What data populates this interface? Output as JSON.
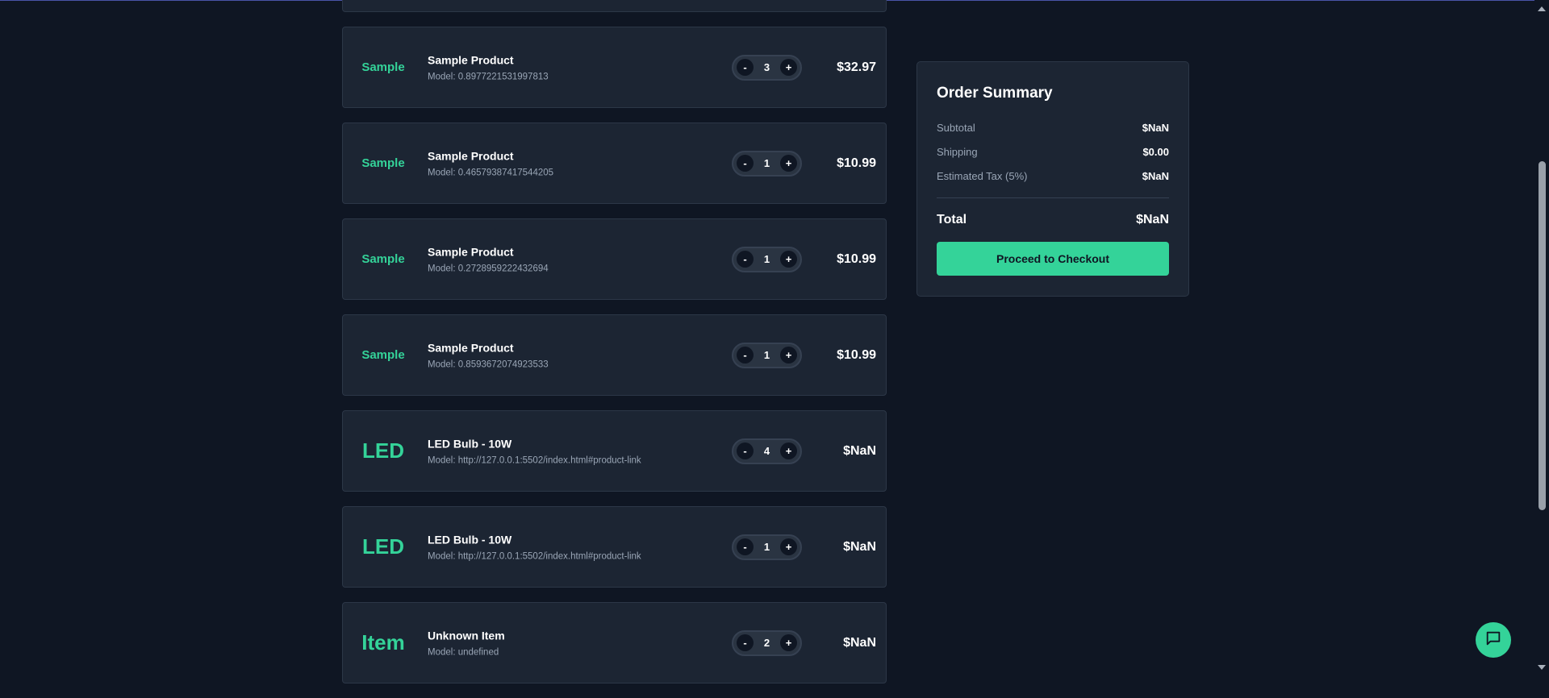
{
  "cart": {
    "items": [
      {
        "thumb": "",
        "name": "",
        "model": "",
        "qty": "",
        "price": ""
      },
      {
        "thumb": "Sample",
        "name": "Sample Product",
        "model": "Model: 0.8977221531997813",
        "qty": "3",
        "price": "$32.97"
      },
      {
        "thumb": "Sample",
        "name": "Sample Product",
        "model": "Model: 0.46579387417544205",
        "qty": "1",
        "price": "$10.99"
      },
      {
        "thumb": "Sample",
        "name": "Sample Product",
        "model": "Model: 0.2728959222432694",
        "qty": "1",
        "price": "$10.99"
      },
      {
        "thumb": "Sample",
        "name": "Sample Product",
        "model": "Model: 0.8593672074923533",
        "qty": "1",
        "price": "$10.99"
      },
      {
        "thumb": "LED",
        "name": "LED Bulb - 10W",
        "model": "Model: http://127.0.0.1:5502/index.html#product-link",
        "qty": "4",
        "price": "$NaN"
      },
      {
        "thumb": "LED",
        "name": "LED Bulb - 10W",
        "model": "Model: http://127.0.0.1:5502/index.html#product-link",
        "qty": "1",
        "price": "$NaN"
      },
      {
        "thumb": "Item",
        "name": "Unknown Item",
        "model": "Model: undefined",
        "qty": "2",
        "price": "$NaN"
      }
    ],
    "decrement_label": "-",
    "increment_label": "+"
  },
  "summary": {
    "title": "Order Summary",
    "subtotal_label": "Subtotal",
    "subtotal_value": "$NaN",
    "shipping_label": "Shipping",
    "shipping_value": "$0.00",
    "tax_label": "Estimated Tax (5%)",
    "tax_value": "$NaN",
    "total_label": "Total",
    "total_value": "$NaN",
    "checkout_label": "Proceed to Checkout"
  },
  "icons": {
    "chat": "chat-bubble-icon"
  },
  "colors": {
    "accent": "#34d399",
    "background": "#0f1623",
    "card": "#1c2533"
  }
}
